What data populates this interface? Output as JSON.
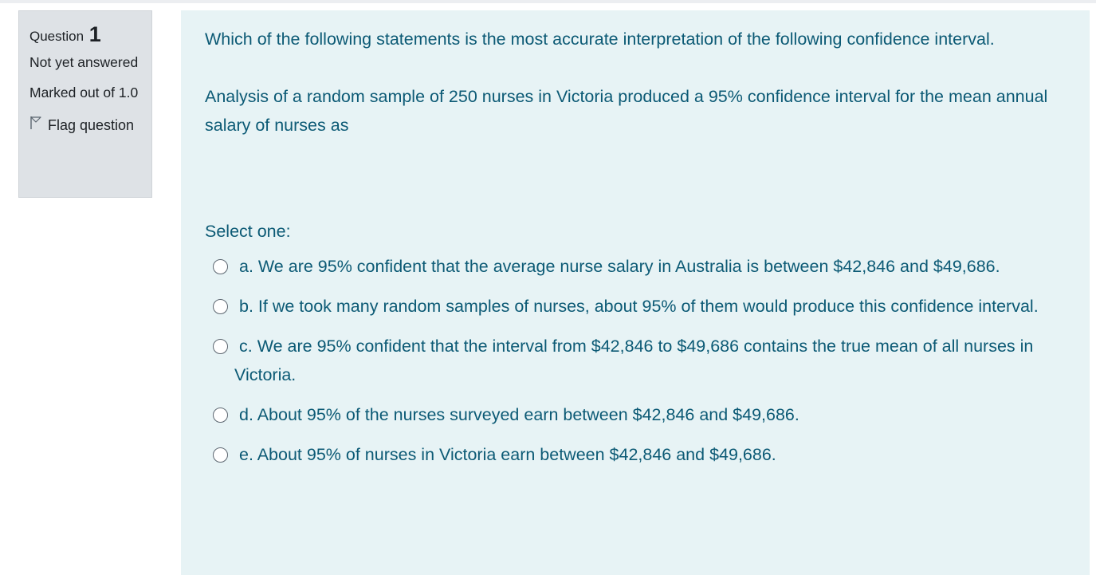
{
  "question_info": {
    "label": "Question",
    "number": "1",
    "state": "Not yet answered",
    "grade": "Marked out of 1.0",
    "flag_label": "Flag question"
  },
  "question": {
    "text": "Which of the following statements is the most accurate interpretation of the following confidence interval.",
    "context": "Analysis of a random sample of 250 nurses in Victoria produced a 95% confidence interval for the mean annual salary of nurses as",
    "prompt": "Select one:",
    "options": [
      {
        "label": "a. We are 95% confident that the average nurse salary in Australia is between $42,846 and $49,686."
      },
      {
        "label": "b. If we took many random samples of nurses, about 95% of them would produce this confidence interval."
      },
      {
        "label": "c. We are 95% confident that the interval from $42,846 to $49,686 contains the true mean of all nurses in Victoria."
      },
      {
        "label": "d. About 95% of the nurses surveyed earn between $42,846 and $49,686."
      },
      {
        "label": "e. About 95% of nurses in Victoria earn between $42,846 and $49,686."
      }
    ]
  },
  "colors": {
    "info_bg": "#dee2e6",
    "content_bg": "#e7f3f5",
    "content_text": "#0c5a75"
  }
}
